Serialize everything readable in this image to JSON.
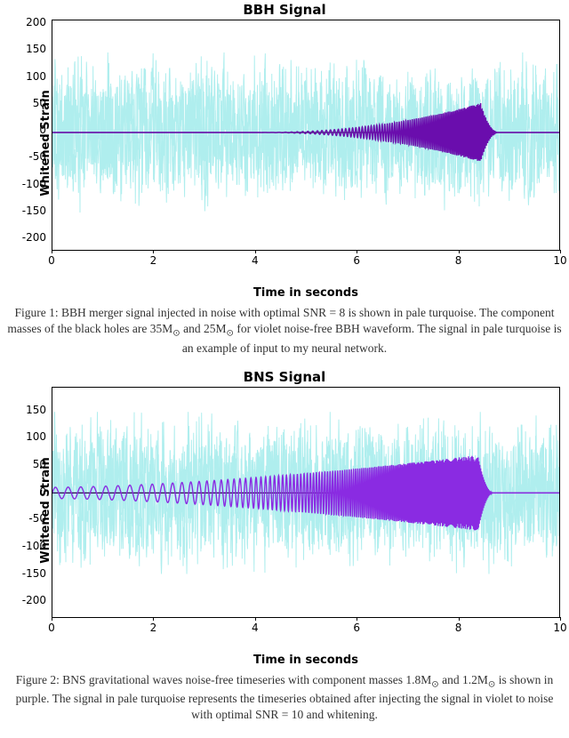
{
  "figure1": {
    "title": "BBH Signal",
    "xlabel": "Time in seconds",
    "ylabel": "Whitened Strain",
    "caption_prefix": "Figure 1: BBH merger signal injected in noise with optimal SNR = 8 is shown in pale turquoise. The component masses of the black holes are 35M",
    "caption_mid": " and 25M",
    "caption_suffix": " for violet noise-free BBH waveform. The signal in pale turquoise is an example of input to my neural network.",
    "yticks": [
      "-200",
      "-150",
      "-100",
      "-50",
      "0",
      "50",
      "100",
      "150",
      "200"
    ],
    "xticks": [
      "0",
      "2",
      "4",
      "6",
      "8",
      "10"
    ]
  },
  "figure2": {
    "title": "BNS Signal",
    "xlabel": "Time in seconds",
    "ylabel": "Whitened Strain",
    "caption_prefix": "Figure 2: BNS gravitational waves noise-free timeseries with component masses 1.8M",
    "caption_mid": " and 1.2M",
    "caption_suffix": " is shown in purple. The signal in pale turquoise represents the timeseries obtained after injecting the signal in violet to noise with optimal SNR = 10 and whitening.",
    "yticks": [
      "-200",
      "-150",
      "-100",
      "-50",
      "0",
      "50",
      "100",
      "150"
    ],
    "xticks": [
      "0",
      "2",
      "4",
      "6",
      "8",
      "10"
    ]
  },
  "chart_data": [
    {
      "type": "line",
      "title": "BBH Signal",
      "xlabel": "Time in seconds",
      "ylabel": "Whitened Strain",
      "xlim": [
        0,
        10
      ],
      "ylim": [
        -220,
        210
      ],
      "series": [
        {
          "name": "noise+signal (pale turquoise)",
          "description": "dense whitened detector noise with injected BBH signal; amplitude envelope roughly ±100‒190 across full 0‒10s range",
          "approx_envelope": {
            "min": -200,
            "max": 195
          }
        },
        {
          "name": "noise-free BBH waveform (violet)",
          "description": "chirp: ~0 amplitude until ~4s, oscillation growing to ~±50 merger near 8.5s, ringdown to 0 by ~8.7s",
          "approx_points": [
            [
              0,
              0
            ],
            [
              3,
              0
            ],
            [
              5,
              3
            ],
            [
              6,
              6
            ],
            [
              7,
              12
            ],
            [
              7.8,
              22
            ],
            [
              8.2,
              35
            ],
            [
              8.45,
              50
            ],
            [
              8.55,
              -45
            ],
            [
              8.6,
              0
            ],
            [
              10,
              0
            ]
          ]
        }
      ]
    },
    {
      "type": "line",
      "title": "BNS Signal",
      "xlabel": "Time in seconds",
      "ylabel": "Whitened Strain",
      "xlim": [
        0,
        10
      ],
      "ylim": [
        -230,
        195
      ],
      "series": [
        {
          "name": "noise+signal (pale turquoise)",
          "description": "dense whitened detector noise with injected BNS signal; amplitude envelope roughly ±100‒190 across full 0‒10s range",
          "approx_envelope": {
            "min": -210,
            "max": 190
          }
        },
        {
          "name": "noise-free BNS waveform (violet)",
          "description": "continuous chirp band visible from 0s (~±10) growing slowly, widening band of oscillation, merger spike ~±70 near 8.4s then ~0",
          "approx_points": [
            [
              0,
              8
            ],
            [
              2,
              10
            ],
            [
              4,
              12
            ],
            [
              6,
              18
            ],
            [
              7,
              25
            ],
            [
              8,
              40
            ],
            [
              8.35,
              70
            ],
            [
              8.45,
              -70
            ],
            [
              8.6,
              0
            ],
            [
              10,
              0
            ]
          ]
        }
      ]
    }
  ],
  "colors": {
    "noise": "#AFEEEE",
    "noise_stroke": "#8FE6E6",
    "signal": "#6A0DAD",
    "signal2": "#8A2BE2",
    "midline": "#2E0854"
  }
}
